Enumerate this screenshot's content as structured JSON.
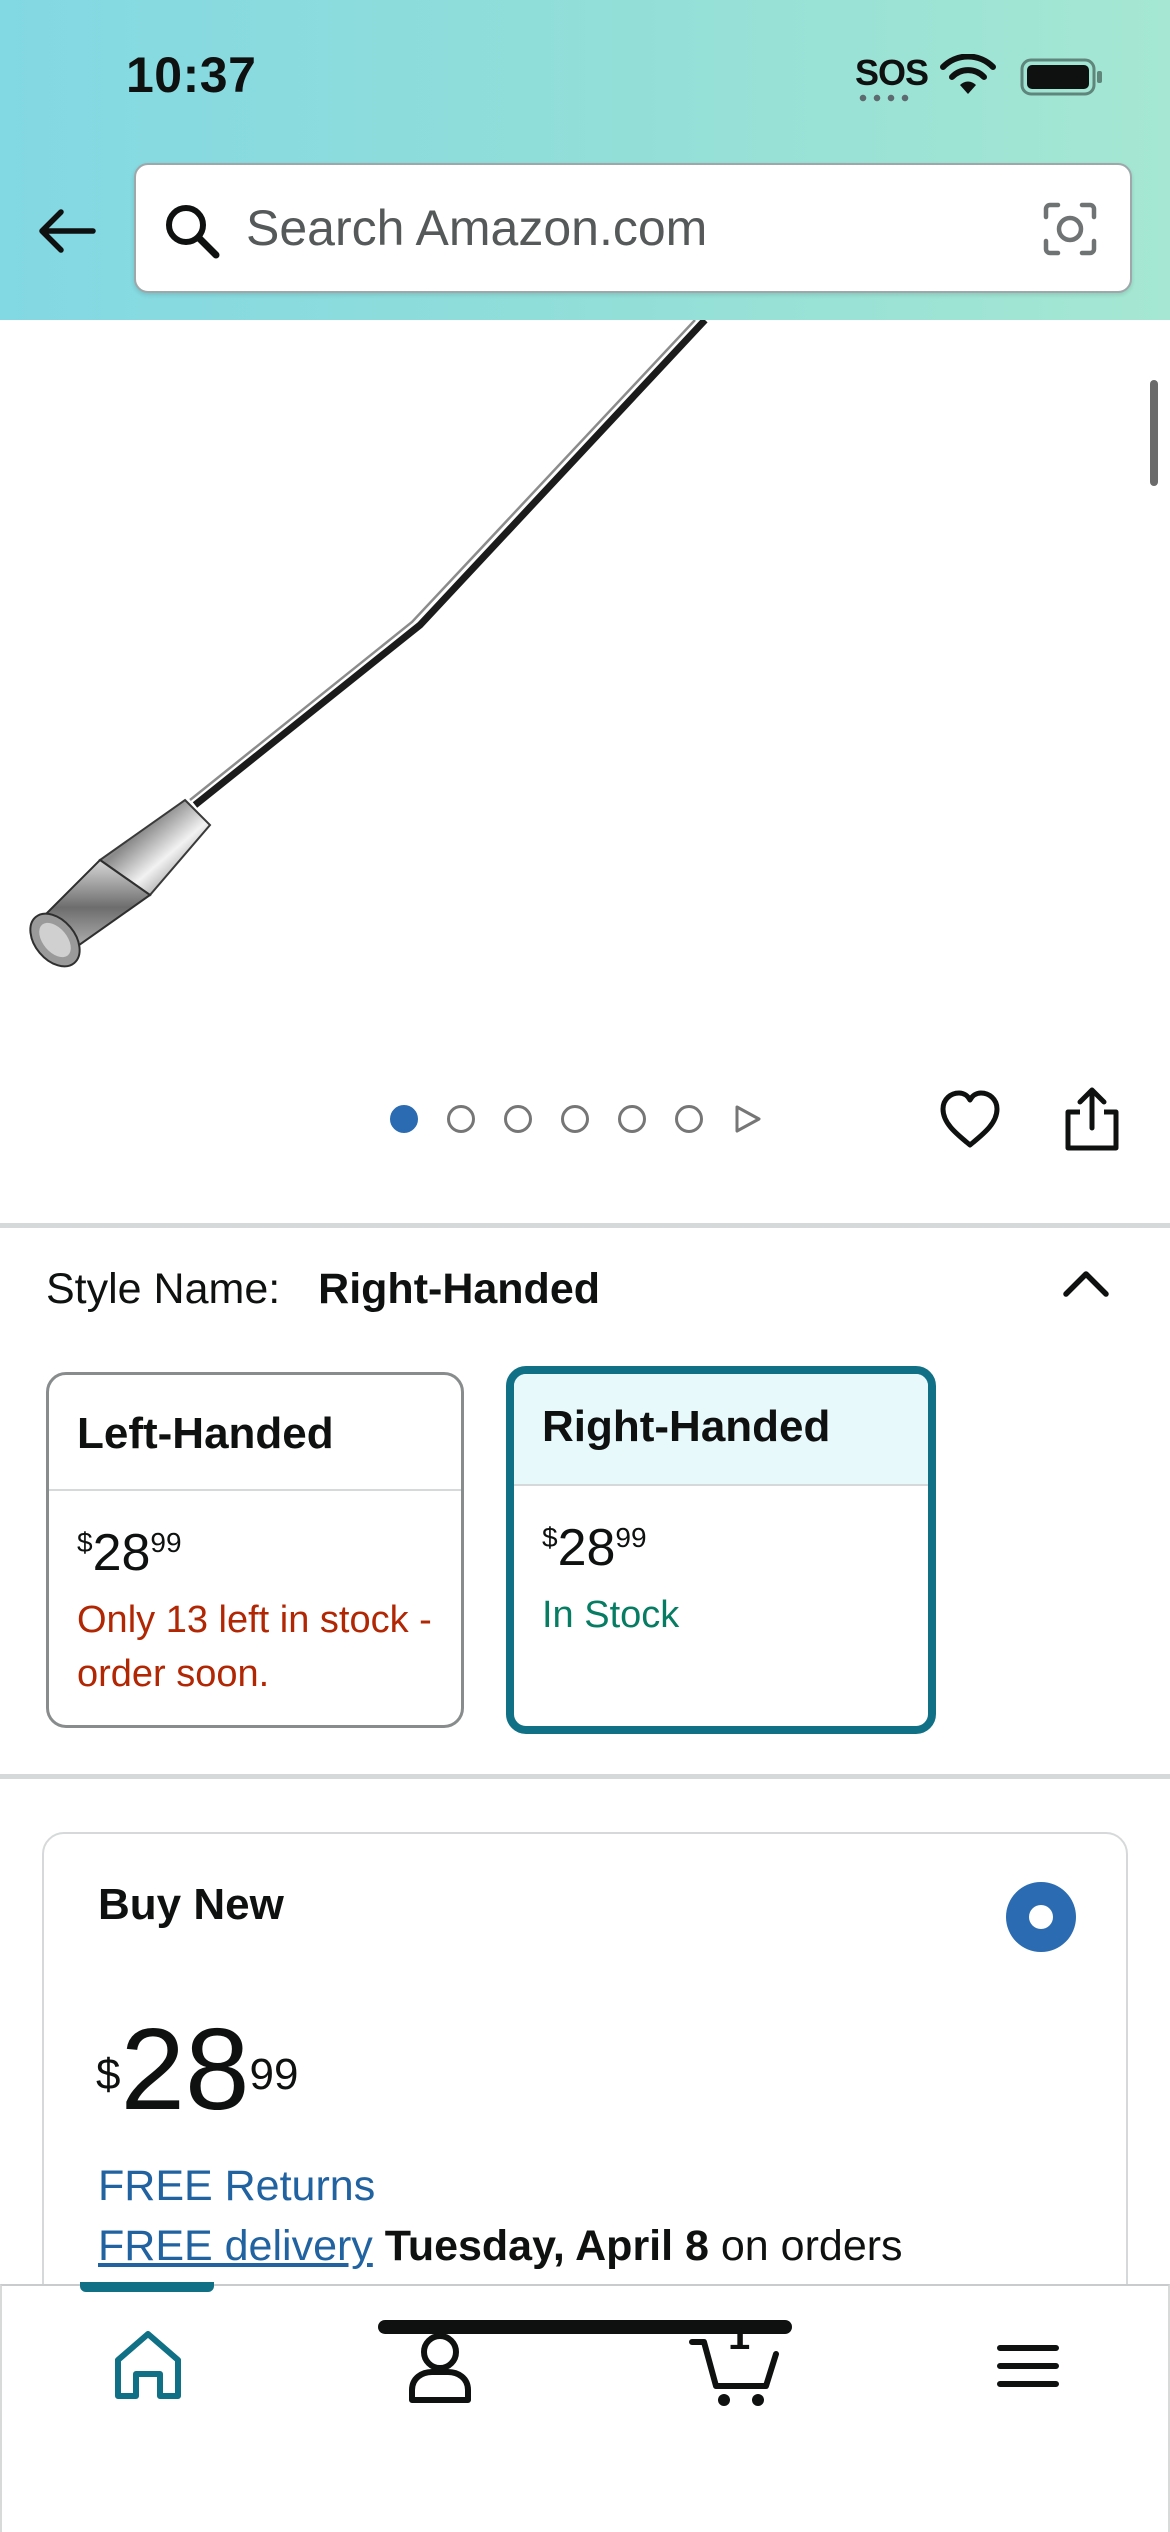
{
  "status_bar": {
    "time": "10:37",
    "sos_label": "SOS",
    "icons": [
      "wifi-icon",
      "battery-icon"
    ]
  },
  "header": {
    "back_icon": "arrow-left-icon",
    "search": {
      "placeholder": "Search Amazon.com",
      "value": "",
      "icons": [
        "search-icon",
        "camera-lens-icon"
      ]
    }
  },
  "gallery": {
    "image_count": 6,
    "active_index": 0,
    "has_video": true,
    "icons": [
      "heart-icon",
      "share-icon",
      "play-icon"
    ]
  },
  "style_selector": {
    "label": "Style Name:",
    "selected": "Right-Handed",
    "options": [
      {
        "name": "Left-Handed",
        "currency": "$",
        "price_whole": "28",
        "price_cents": "99",
        "stock_text": "Only 13 left in stock - order soon.",
        "stock_color": "#b12704",
        "selected": false
      },
      {
        "name": "Right-Handed",
        "currency": "$",
        "price_whole": "28",
        "price_cents": "99",
        "stock_text": "In Stock",
        "stock_color": "#067d62",
        "selected": true
      }
    ]
  },
  "buy_box": {
    "title": "Buy New",
    "currency": "$",
    "price_whole": "28",
    "price_cents": "99",
    "free_returns": "FREE Returns",
    "delivery_link": "FREE delivery",
    "delivery_date": "Tuesday, April 8",
    "delivery_suffix": "on orders"
  },
  "bottom_nav": {
    "items": [
      {
        "name": "home",
        "icon": "home-icon",
        "active": true
      },
      {
        "name": "account",
        "icon": "person-icon",
        "active": false
      },
      {
        "name": "cart",
        "icon": "cart-icon",
        "count": "1",
        "active": false
      },
      {
        "name": "menu",
        "icon": "hamburger-menu-icon",
        "active": false
      }
    ]
  },
  "colors": {
    "accent_teal": "#0f7086",
    "link_blue": "#2162a1",
    "dot_active": "#2b6bb1",
    "stock_low": "#b12704",
    "stock_ok": "#067d62"
  }
}
